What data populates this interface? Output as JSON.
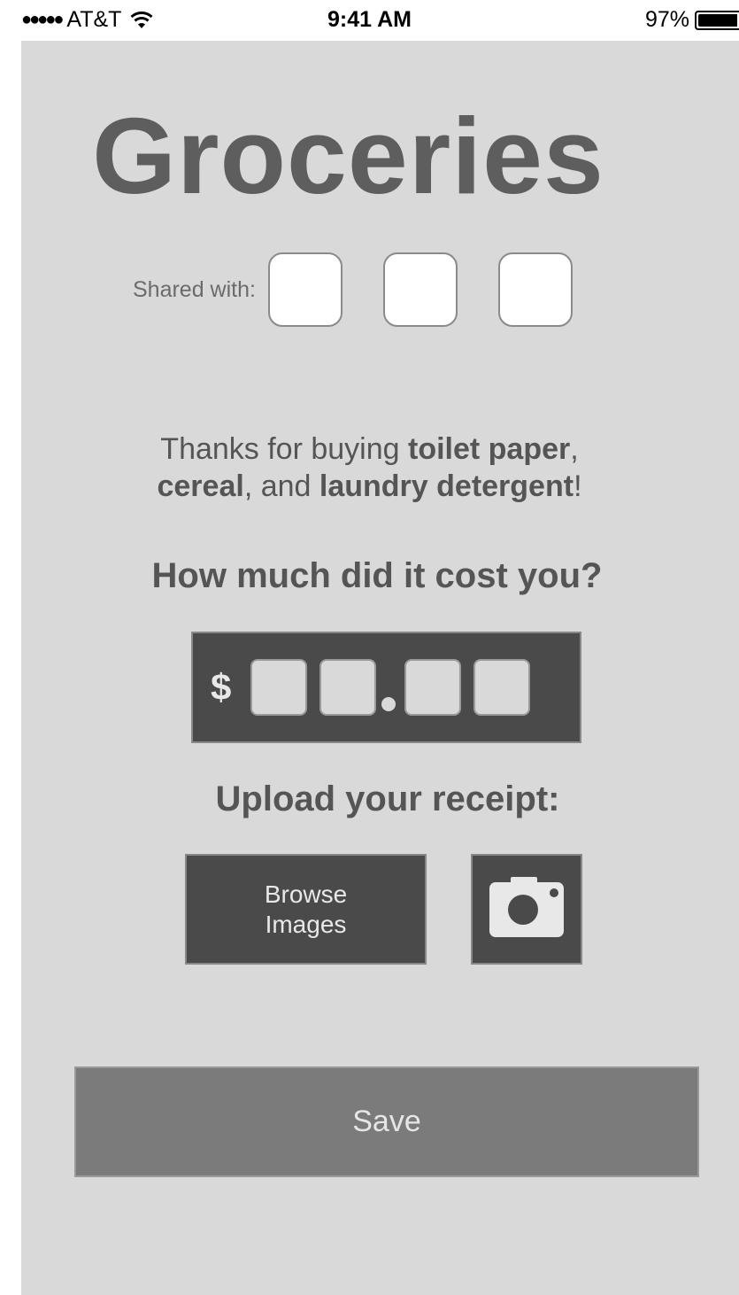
{
  "status_bar": {
    "signal": "●●●●●",
    "carrier": "AT&T",
    "time": "9:41 AM",
    "battery_percent": "97%"
  },
  "screen": {
    "title": "Groceries",
    "shared_with_label": "Shared with:",
    "shared_slots": 3,
    "thanks": {
      "prefix": "Thanks for buying ",
      "item1": "toilet paper",
      "sep1": ",",
      "item2": "cereal",
      "sep2": ", and ",
      "item3": "laundry detergent",
      "suffix": "!"
    },
    "cost_question": "How much did it cost you?",
    "currency_symbol": "$",
    "upload_label": "Upload your receipt:",
    "browse_button": {
      "line1": "Browse",
      "line2": "Images"
    },
    "camera_button_icon": "camera-icon",
    "save_button": "Save"
  },
  "colors": {
    "background": "#d9d9d9",
    "dark_panel": "#4a4a4a",
    "save_button": "#7b7b7b",
    "title_text": "#5e5e5e"
  }
}
